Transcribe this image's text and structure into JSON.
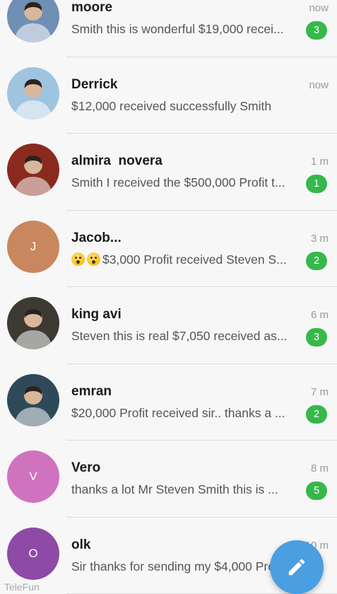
{
  "chats": [
    {
      "name": "moore",
      "time": "now",
      "preview": "Smith this is wonderful $19,000 recei...",
      "badge": "3",
      "avatar": {
        "kind": "photo",
        "bg": "#6f8fb5"
      }
    },
    {
      "name": "Derrick",
      "time": "now",
      "preview": "$12,000 received successfully Smith",
      "badge": "",
      "avatar": {
        "kind": "photo",
        "bg": "#9fc4e0"
      }
    },
    {
      "name": "almira  novera",
      "time": "1 m",
      "preview": "Smith I received the $500,000 Profit t...",
      "badge": "1",
      "avatar": {
        "kind": "photo",
        "bg": "#8a2a1e"
      }
    },
    {
      "name": "Jacob...",
      "time": "3 m",
      "preview": "$3,000 Profit received Steven S...",
      "emoji_count": 2,
      "badge": "2",
      "avatar": {
        "kind": "initial",
        "letter": "J",
        "bg": "#c9875f"
      }
    },
    {
      "name": "king avi",
      "time": "6 m",
      "preview": "Steven this is real $7,050 received as...",
      "badge": "3",
      "avatar": {
        "kind": "photo",
        "bg": "#3d3a33"
      }
    },
    {
      "name": "emran",
      "time": "7 m",
      "preview": "$20,000 Profit received sir.. thanks a ...",
      "badge": "2",
      "avatar": {
        "kind": "photo",
        "bg": "#2e4a58"
      }
    },
    {
      "name": "Vero",
      "time": "8 m",
      "preview": "thanks a lot Mr Steven Smith this is ...",
      "badge": "5",
      "avatar": {
        "kind": "initial",
        "letter": "V",
        "bg": "#cf73bf"
      }
    },
    {
      "name": "olk",
      "time": "10 m",
      "preview": "Sir thanks for sending my $4,000 Profit",
      "badge": "",
      "avatar": {
        "kind": "initial",
        "letter": "O",
        "bg": "#8e4aa6"
      }
    }
  ],
  "fab": {
    "icon": "pencil-icon",
    "color": "#4a9ee2"
  },
  "watermark": "TeleFun",
  "colors": {
    "badge": "#36b84a",
    "background": "#f7f7f7"
  }
}
